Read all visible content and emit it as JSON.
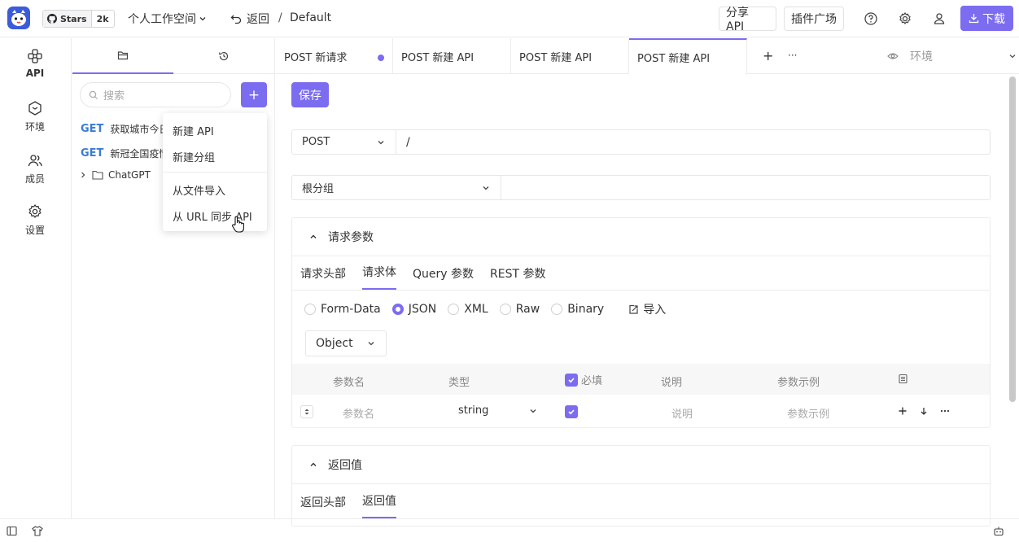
{
  "topbar": {
    "logo_icon": "app-cat-logo",
    "github_stars_label": "Stars",
    "github_stars_count": "2k",
    "workspace": "个人工作空间",
    "back_label": "返回",
    "breadcrumb_sep": "/",
    "breadcrumb_current": "Default",
    "share_label": "分享 API",
    "plugins_label": "插件广场",
    "download_label": "下载",
    "accent_color": "#7b6cf0"
  },
  "rail": {
    "items": [
      {
        "label": "API",
        "icon": "api-icon"
      },
      {
        "label": "环境",
        "icon": "environment-icon"
      },
      {
        "label": "成员",
        "icon": "members-icon"
      },
      {
        "label": "设置",
        "icon": "settings-icon"
      }
    ]
  },
  "sidepanel": {
    "search_placeholder": "搜索",
    "add_label": "+",
    "apis": [
      {
        "method": "GET",
        "name": "获取城市今日"
      },
      {
        "method": "GET",
        "name": "新冠全国疫情"
      }
    ],
    "folder": "ChatGPT"
  },
  "dropdown": {
    "items": [
      "新建 API",
      "新建分组",
      "从文件导入",
      "从 URL 同步 API"
    ]
  },
  "tabs": [
    {
      "label": "POST 新请求",
      "unsaved": true
    },
    {
      "label": "POST 新建 API"
    },
    {
      "label": "POST 新建 API"
    },
    {
      "label": "POST 新建 API",
      "active": true
    }
  ],
  "tab_actions": {
    "add": "+",
    "more": "···"
  },
  "env": {
    "label": "环境"
  },
  "main": {
    "save_label": "保存",
    "method": "POST",
    "url": "/",
    "group": "根分组",
    "request": {
      "title": "请求参数",
      "subtabs": [
        "请求头部",
        "请求体",
        "Query 参数",
        "REST 参数"
      ],
      "active_subtab": "请求体",
      "body_types": [
        "Form-Data",
        "JSON",
        "XML",
        "Raw",
        "Binary"
      ],
      "selected_body_type": "JSON",
      "import_label": "导入",
      "root_type": "Object",
      "columns": {
        "name": "参数名",
        "type": "类型",
        "required": "必填",
        "desc": "说明",
        "example": "参数示例"
      },
      "row": {
        "name_ph": "参数名",
        "type": "string",
        "desc_ph": "说明",
        "example_ph": "参数示例"
      }
    },
    "response": {
      "title": "返回值",
      "subtabs": [
        "返回头部",
        "返回值"
      ],
      "active_subtab": "返回值"
    }
  }
}
